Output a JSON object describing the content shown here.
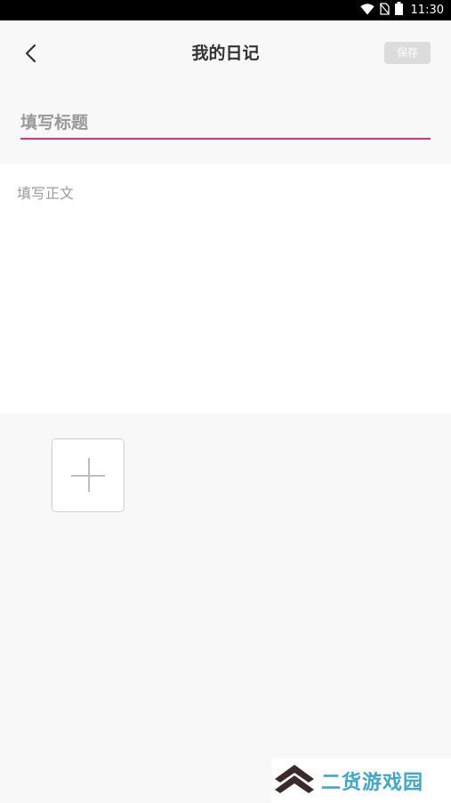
{
  "status_bar": {
    "time": "11:30",
    "icons": [
      "wifi-icon",
      "no-sim-icon",
      "battery-icon"
    ]
  },
  "header": {
    "title": "我的日记",
    "save_label": "保存",
    "back_icon": "chevron-left-icon"
  },
  "editor": {
    "title_placeholder": "填写标题",
    "title_value": "",
    "body_placeholder": "填写正文",
    "body_value": "",
    "accent_color": "#d63769"
  },
  "media": {
    "add_icon": "plus-icon"
  },
  "watermark": {
    "text": "二货游戏园"
  }
}
